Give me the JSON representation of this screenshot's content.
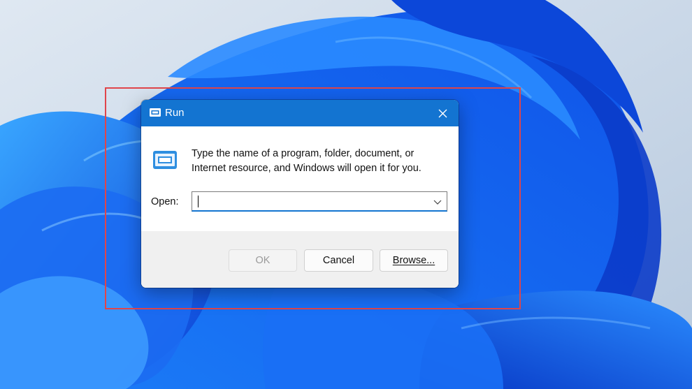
{
  "dialog": {
    "title": "Run",
    "description": "Type the name of a program, folder, document, or Internet resource, and Windows will open it for you.",
    "open_label": "Open:",
    "open_value": "",
    "buttons": {
      "ok": "OK",
      "cancel": "Cancel",
      "browse": "Browse..."
    }
  },
  "colors": {
    "title_bar": "#1374d1",
    "highlight_border": "#e0454a",
    "footer": "#f0f0f0"
  },
  "icons": [
    "run-app-icon",
    "close-icon",
    "chevron-down-icon"
  ]
}
